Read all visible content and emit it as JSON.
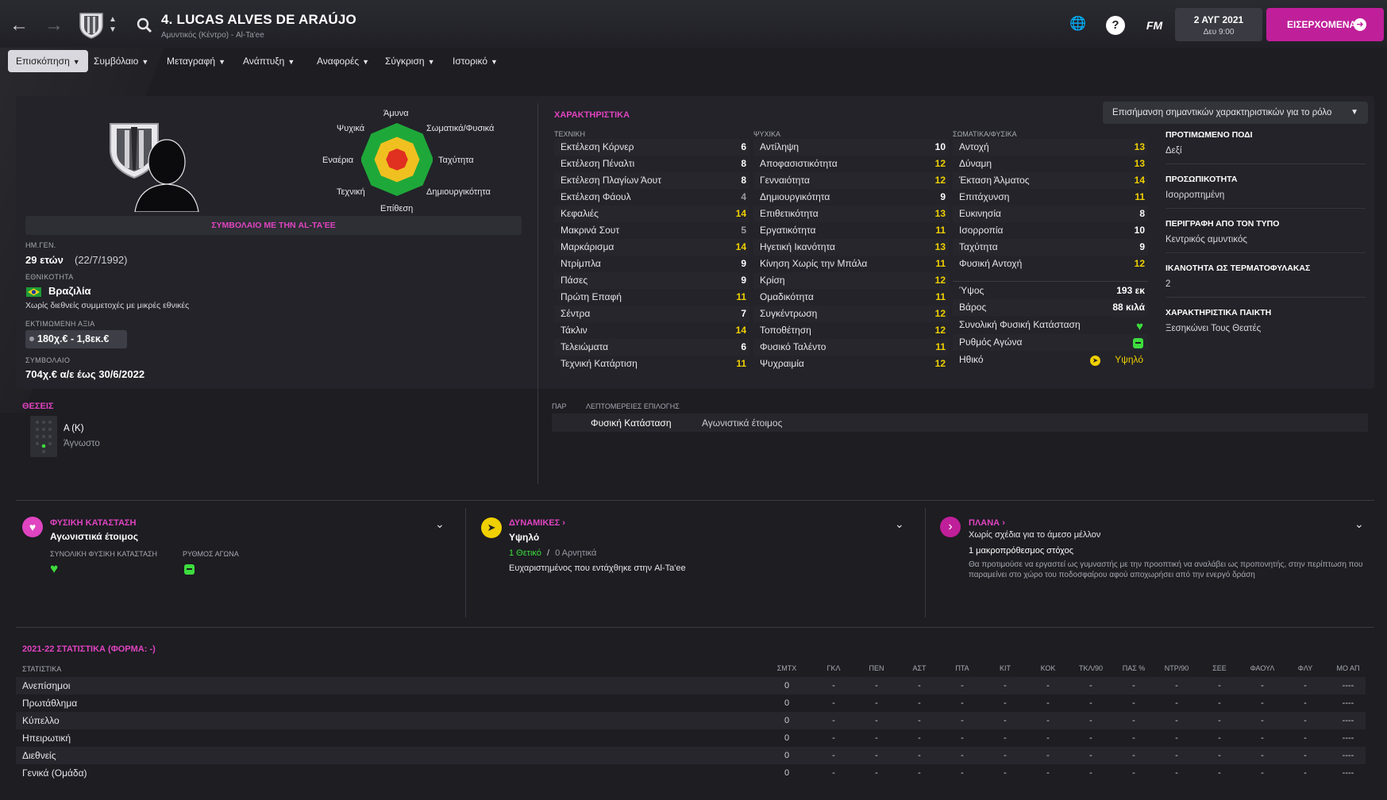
{
  "header": {
    "title": "4. LUCAS ALVES DE ARAÚJO",
    "subtitle": "Αμυντικός (Κέντρο) - Al-Ta'ee",
    "fm_label": "FM",
    "help_label": "?",
    "date_line1": "2 ΑΥΓ 2021",
    "date_line2": "Δευ 9:00",
    "next_button": "ΕΙΣΕΡΧΟΜΕΝΑ"
  },
  "menu": [
    {
      "label": "Επισκόπηση"
    },
    {
      "label": "Συμβόλαιο"
    },
    {
      "label": "Μεταγραφή"
    },
    {
      "label": "Ανάπτυξη"
    },
    {
      "label": "Αναφορές"
    },
    {
      "label": "Σύγκριση"
    },
    {
      "label": "Ιστορικό"
    }
  ],
  "profile": {
    "radar_labels": {
      "top": "Άμυνα",
      "top_right": "Σωματικά/Φυσικά",
      "right": "Ταχύτητα",
      "bottom_right": "Δημιουργικότητα",
      "bottom": "Επίθεση",
      "bottom_left": "Τεχνική",
      "left": "Εναέρια",
      "top_left": "Ψυχικά"
    },
    "radar_levels": {
      "outer": 1.0,
      "middle": 0.62,
      "inner": 0.3
    },
    "contract_banner": "ΣΥΜΒΟΛΑΙΟ ΜΕ ΤΗΝ AL-TA'EE",
    "dob_label": "ΗΜ.ΓΕΝ.",
    "age": "29 ετών",
    "dob": "(22/7/1992)",
    "nationality_label": "ΕΘΝΙΚΟΤΗΤΑ",
    "nationality": "Βραζιλία",
    "caps_note": "Χωρίς διεθνείς συμμετοχές με μικρές εθνικές",
    "value_label": "ΕΚΤΙΜΩΜΕΝΗ ΑΞΙΑ",
    "value": "180χ.€ - 1,8εκ.€",
    "contract_label": "ΣΥΜΒΟΛΑΙΟ",
    "contract": "704χ.€ α/ε έως 30/6/2022"
  },
  "attributes": {
    "title": "ΧΑΡΑΚΤΗΡΙΣΤΙΚΑ",
    "highlight_dropdown": "Επισήμανση σημαντικών χαρακτηριστικών για το ρόλο",
    "technical_head": "ΤΕΧΝΙΚΗ",
    "mental_head": "ΨΥΧΙΚΑ",
    "physical_head": "ΣΩΜΑΤΙΚΑ/ΦΥΣΙΚΑ",
    "technical": [
      {
        "name": "Εκτέλεση Κόρνερ",
        "value": "6",
        "hl": "w"
      },
      {
        "name": "Εκτέλεση Πέναλτι",
        "value": "8",
        "hl": "w"
      },
      {
        "name": "Εκτέλεση Πλαγίων Άουτ",
        "value": "8",
        "hl": "w"
      },
      {
        "name": "Εκτέλεση Φάουλ",
        "value": "4",
        "hl": "g"
      },
      {
        "name": "Κεφαλιές",
        "value": "14",
        "hl": "y"
      },
      {
        "name": "Μακρινά Σουτ",
        "value": "5",
        "hl": "g"
      },
      {
        "name": "Μαρκάρισμα",
        "value": "14",
        "hl": "y"
      },
      {
        "name": "Ντρίμπλα",
        "value": "9",
        "hl": "w"
      },
      {
        "name": "Πάσες",
        "value": "9",
        "hl": "w"
      },
      {
        "name": "Πρώτη Επαφή",
        "value": "11",
        "hl": "y"
      },
      {
        "name": "Σέντρα",
        "value": "7",
        "hl": "w"
      },
      {
        "name": "Τάκλιν",
        "value": "14",
        "hl": "y"
      },
      {
        "name": "Τελειώματα",
        "value": "6",
        "hl": "w"
      },
      {
        "name": "Τεχνική Κατάρτιση",
        "value": "11",
        "hl": "y"
      }
    ],
    "mental": [
      {
        "name": "Αντίληψη",
        "value": "10",
        "hl": "w"
      },
      {
        "name": "Αποφασιστικότητα",
        "value": "12",
        "hl": "y"
      },
      {
        "name": "Γενναιότητα",
        "value": "12",
        "hl": "y"
      },
      {
        "name": "Δημιουργικότητα",
        "value": "9",
        "hl": "w"
      },
      {
        "name": "Επιθετικότητα",
        "value": "13",
        "hl": "y"
      },
      {
        "name": "Εργατικότητα",
        "value": "11",
        "hl": "y"
      },
      {
        "name": "Ηγετική Ικανότητα",
        "value": "13",
        "hl": "y"
      },
      {
        "name": "Κίνηση Χωρίς την Μπάλα",
        "value": "11",
        "hl": "y"
      },
      {
        "name": "Κρίση",
        "value": "12",
        "hl": "y"
      },
      {
        "name": "Ομαδικότητα",
        "value": "11",
        "hl": "y"
      },
      {
        "name": "Συγκέντρωση",
        "value": "12",
        "hl": "y"
      },
      {
        "name": "Τοποθέτηση",
        "value": "12",
        "hl": "y"
      },
      {
        "name": "Φυσικό Ταλέντο",
        "value": "11",
        "hl": "y"
      },
      {
        "name": "Ψυχραιμία",
        "value": "12",
        "hl": "y"
      }
    ],
    "physical": [
      {
        "name": "Αντοχή",
        "value": "13",
        "hl": "y"
      },
      {
        "name": "Δύναμη",
        "value": "13",
        "hl": "y"
      },
      {
        "name": "Έκταση Άλματος",
        "value": "14",
        "hl": "y"
      },
      {
        "name": "Επιτάχυνση",
        "value": "11",
        "hl": "y"
      },
      {
        "name": "Ευκινησία",
        "value": "8",
        "hl": "w"
      },
      {
        "name": "Ισορροπία",
        "value": "10",
        "hl": "w"
      },
      {
        "name": "Ταχύτητα",
        "value": "9",
        "hl": "w"
      },
      {
        "name": "Φυσική Αντοχή",
        "value": "12",
        "hl": "y"
      }
    ],
    "height_label": "Ύψος",
    "height": "193 εκ",
    "weight_label": "Βάρος",
    "weight": "88 κιλά",
    "overall_condition_label": "Συνολική Φυσική Κατάσταση",
    "match_rhythm_label": "Ρυθμός Αγώνα",
    "morale_label": "Ηθικό",
    "morale_value": "Υψηλό"
  },
  "info": {
    "foot_label": "ΠΡΟΤΙΜΩΜΕΝΟ ΠΟΔΙ",
    "foot": "Δεξί",
    "personality_label": "ΠΡΟΣΩΠΙΚΟΤΗΤΑ",
    "personality": "Ισορροπημένη",
    "media_label": "ΠΕΡΙΓΡΑΦΗ ΑΠΟ ΤΟΝ ΤΥΠΟ",
    "media": "Κεντρικός αμυντικός",
    "gk_label": "ΙΚΑΝΟΤΗΤΑ ΩΣ ΤΕΡΜΑΤΟΦΥΛΑΚΑΣ",
    "gk": "2",
    "traits_label": "ΧΑΡΑΚΤΗΡΙΣΤΙΚΑ ΠΑΙΚΤΗ",
    "traits": "Ξεσηκώνει Τους Θεατές"
  },
  "positions": {
    "title": "ΘΕΣΕΙΣ",
    "pos": "Α (Κ)",
    "familiarity": "Άγνωστο"
  },
  "selection": {
    "col1": "ΠΑΡ",
    "col2": "ΛΕΠΤΟΜΕΡΕΙΕΣ ΕΠΙΛΟΓΗΣ",
    "item1": "Φυσική Κατάσταση",
    "item2": "Αγωνιστικά έτοιμος"
  },
  "condition_card": {
    "title": "ΦΥΣΙΚΗ ΚΑΤΑΣΤΑΣΗ",
    "status": "Αγωνιστικά έτοιμος",
    "overall_label": "ΣΥΝΟΛΙΚΗ ΦΥΣΙΚΗ ΚΑΤΑΣΤΑΣΗ",
    "rhythm_label": "ΡΥΘΜΟΣ ΑΓΩΝΑ"
  },
  "dynamics_card": {
    "title": "ΔΥΝΑΜΙΚΕΣ",
    "level": "Υψηλό",
    "positive": "1 Θετικό",
    "sep": "/",
    "negative": "0 Αρνητικά",
    "note": "Ευχαριστημένος που εντάχθηκε στην Al-Ta'ee"
  },
  "plans_card": {
    "title": "ΠΛΑΝΑ",
    "status": "Χωρίς σχέδια για το άμεσο μέλλον",
    "goal": "1 μακροπρόθεσμος στόχος",
    "desc": "Θα προτιμούσε να εργαστεί ως γυμναστής με την προοπτική να αναλάβει ως προπονητής, στην περίπτωση που παραμείνει στο χώρο του ποδοσφαίρου αφού αποχωρήσει από την ενεργό δράση"
  },
  "stats": {
    "title": "2021-22 ΣΤΑΤΙΣΤΙΚΑ (ΦΟΡΜΑ: -)",
    "row_head": "ΣΤΑΤΙΣΤΙΚΑ",
    "columns": [
      "ΣΜΤΧ",
      "ΓΚΛ",
      "ΠΕΝ",
      "ΑΣΤ",
      "ΠΤΑ",
      "ΚΙΤ",
      "ΚΟΚ",
      "ΤΚΛ/90",
      "ΠΑΣ %",
      "ΝΤΡ/90",
      "ΣΕΕ",
      "ΦΑΟΥΛ",
      "ΦΛΥ",
      "ΜΟ ΑΠ"
    ],
    "rows": [
      {
        "name": "Ανεπίσημοι",
        "cells": [
          "0",
          "-",
          "-",
          "-",
          "-",
          "-",
          "-",
          "-",
          "-",
          "-",
          "-",
          "-",
          "-",
          "----"
        ]
      },
      {
        "name": "Πρωτάθλημα",
        "cells": [
          "0",
          "-",
          "-",
          "-",
          "-",
          "-",
          "-",
          "-",
          "-",
          "-",
          "-",
          "-",
          "-",
          "----"
        ]
      },
      {
        "name": "Κύπελλο",
        "cells": [
          "0",
          "-",
          "-",
          "-",
          "-",
          "-",
          "-",
          "-",
          "-",
          "-",
          "-",
          "-",
          "-",
          "----"
        ]
      },
      {
        "name": "Ηπειρωτική",
        "cells": [
          "0",
          "-",
          "-",
          "-",
          "-",
          "-",
          "-",
          "-",
          "-",
          "-",
          "-",
          "-",
          "-",
          "----"
        ]
      },
      {
        "name": "Διεθνείς",
        "cells": [
          "0",
          "-",
          "-",
          "-",
          "-",
          "-",
          "-",
          "-",
          "-",
          "-",
          "-",
          "-",
          "-",
          "----"
        ]
      },
      {
        "name": "Γενικά (Ομάδα)",
        "cells": [
          "0",
          "-",
          "-",
          "-",
          "-",
          "-",
          "-",
          "-",
          "-",
          "-",
          "-",
          "-",
          "-",
          "----"
        ]
      }
    ]
  },
  "colors": {
    "accent": "#c01f9a",
    "pink_text": "#e044c0",
    "highlight": "#f0d000",
    "good": "#3ddc3d"
  }
}
